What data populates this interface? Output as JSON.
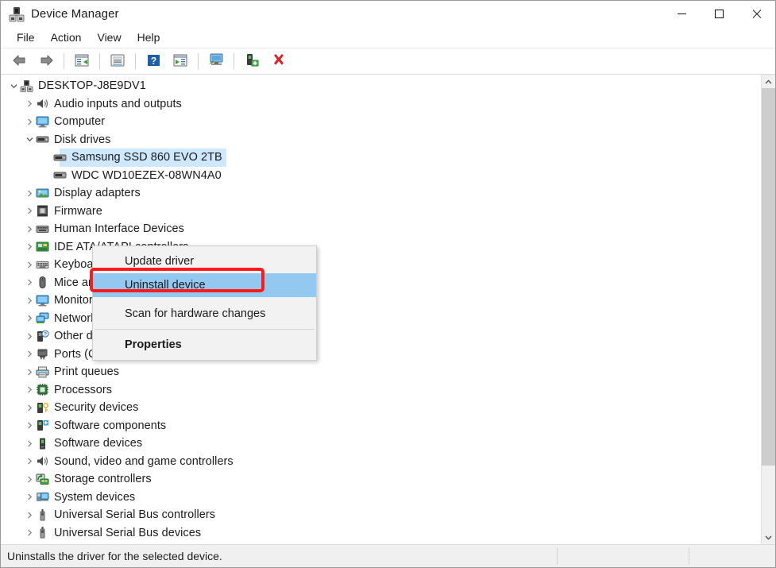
{
  "window": {
    "title": "Device Manager",
    "icon": "device-manager-icon",
    "controls": {
      "minimize": "minimize-icon",
      "maximize": "maximize-icon",
      "close": "close-icon"
    }
  },
  "menubar": {
    "items": [
      {
        "label": "File"
      },
      {
        "label": "Action"
      },
      {
        "label": "View"
      },
      {
        "label": "Help"
      }
    ]
  },
  "toolbar": {
    "buttons": [
      {
        "name": "back-icon"
      },
      {
        "name": "forward-icon"
      },
      {
        "name": "show-hide-console-tree-icon"
      },
      {
        "name": "properties-icon"
      },
      {
        "name": "help-icon"
      },
      {
        "name": "update-driver-icon"
      },
      {
        "name": "scan-for-hardware-changes-icon"
      },
      {
        "name": "add-legacy-hardware-icon"
      },
      {
        "name": "uninstall-device-icon"
      }
    ]
  },
  "tree": {
    "nodes": [
      {
        "label": "DESKTOP-J8E9DV1",
        "depth": 0,
        "twisty": "expanded",
        "icon": "computer-root-icon",
        "selected": false
      },
      {
        "label": "Audio inputs and outputs",
        "depth": 1,
        "twisty": "collapsed",
        "icon": "speaker-icon",
        "selected": false
      },
      {
        "label": "Computer",
        "depth": 1,
        "twisty": "collapsed",
        "icon": "monitor-icon",
        "selected": false
      },
      {
        "label": "Disk drives",
        "depth": 1,
        "twisty": "expanded",
        "icon": "disk-drive-icon",
        "selected": false
      },
      {
        "label": "Samsung SSD 860 EVO 2TB",
        "depth": 2,
        "twisty": "none",
        "icon": "disk-drive-icon",
        "selected": true
      },
      {
        "label": "WDC WD10EZEX-08WN4A0",
        "depth": 2,
        "twisty": "none",
        "icon": "disk-drive-icon",
        "selected": false
      },
      {
        "label": "Display adapters",
        "depth": 1,
        "twisty": "collapsed",
        "icon": "display-adapter-icon",
        "selected": false
      },
      {
        "label": "Firmware",
        "depth": 1,
        "twisty": "collapsed",
        "icon": "firmware-icon",
        "selected": false
      },
      {
        "label": "Human Interface Devices",
        "depth": 1,
        "twisty": "collapsed",
        "icon": "hid-icon",
        "selected": false
      },
      {
        "label": "IDE ATA/ATAPI controllers",
        "depth": 1,
        "twisty": "collapsed",
        "icon": "ide-controller-icon",
        "selected": false
      },
      {
        "label": "Keyboards",
        "depth": 1,
        "twisty": "collapsed",
        "icon": "keyboard-icon",
        "selected": false
      },
      {
        "label": "Mice and other pointing devices",
        "depth": 1,
        "twisty": "collapsed",
        "icon": "mouse-icon",
        "selected": false
      },
      {
        "label": "Monitors",
        "depth": 1,
        "twisty": "collapsed",
        "icon": "monitor-icon",
        "selected": false
      },
      {
        "label": "Network adapters",
        "depth": 1,
        "twisty": "collapsed",
        "icon": "network-adapter-icon",
        "selected": false
      },
      {
        "label": "Other devices",
        "depth": 1,
        "twisty": "collapsed",
        "icon": "other-device-icon",
        "selected": false
      },
      {
        "label": "Ports (COM & LPT)",
        "depth": 1,
        "twisty": "collapsed",
        "icon": "port-icon",
        "selected": false
      },
      {
        "label": "Print queues",
        "depth": 1,
        "twisty": "collapsed",
        "icon": "printer-icon",
        "selected": false
      },
      {
        "label": "Processors",
        "depth": 1,
        "twisty": "collapsed",
        "icon": "processor-icon",
        "selected": false
      },
      {
        "label": "Security devices",
        "depth": 1,
        "twisty": "collapsed",
        "icon": "security-device-icon",
        "selected": false
      },
      {
        "label": "Software components",
        "depth": 1,
        "twisty": "collapsed",
        "icon": "software-component-icon",
        "selected": false
      },
      {
        "label": "Software devices",
        "depth": 1,
        "twisty": "collapsed",
        "icon": "software-device-icon",
        "selected": false
      },
      {
        "label": "Sound, video and game controllers",
        "depth": 1,
        "twisty": "collapsed",
        "icon": "speaker-icon",
        "selected": false
      },
      {
        "label": "Storage controllers",
        "depth": 1,
        "twisty": "collapsed",
        "icon": "storage-controller-icon",
        "selected": false
      },
      {
        "label": "System devices",
        "depth": 1,
        "twisty": "collapsed",
        "icon": "system-device-icon",
        "selected": false
      },
      {
        "label": "Universal Serial Bus controllers",
        "depth": 1,
        "twisty": "collapsed",
        "icon": "usb-icon",
        "selected": false
      },
      {
        "label": "Universal Serial Bus devices",
        "depth": 1,
        "twisty": "collapsed",
        "icon": "usb-icon",
        "selected": false
      }
    ]
  },
  "context_menu": {
    "items": [
      {
        "label": "Update driver",
        "highlighted": false,
        "bold": false
      },
      {
        "label": "Uninstall device",
        "highlighted": true,
        "bold": false
      },
      {
        "label": "Scan for hardware changes",
        "highlighted": false,
        "bold": false
      },
      {
        "label": "Properties",
        "highlighted": false,
        "bold": true
      }
    ]
  },
  "annotation": {
    "color": "#fc1b1b",
    "target": "Uninstall device"
  },
  "statusbar": {
    "text": "Uninstalls the driver for the selected device."
  },
  "scrollbar": {
    "up_arrow": "chevron-up-icon",
    "down_arrow": "chevron-down-icon"
  },
  "colors": {
    "selection": "#cde8ff",
    "menu_highlight": "#93c9f0",
    "annotation_red": "#fc1b1b",
    "menu_bg": "#f2f2f2",
    "statusbar_bg": "#f0f0f0"
  }
}
